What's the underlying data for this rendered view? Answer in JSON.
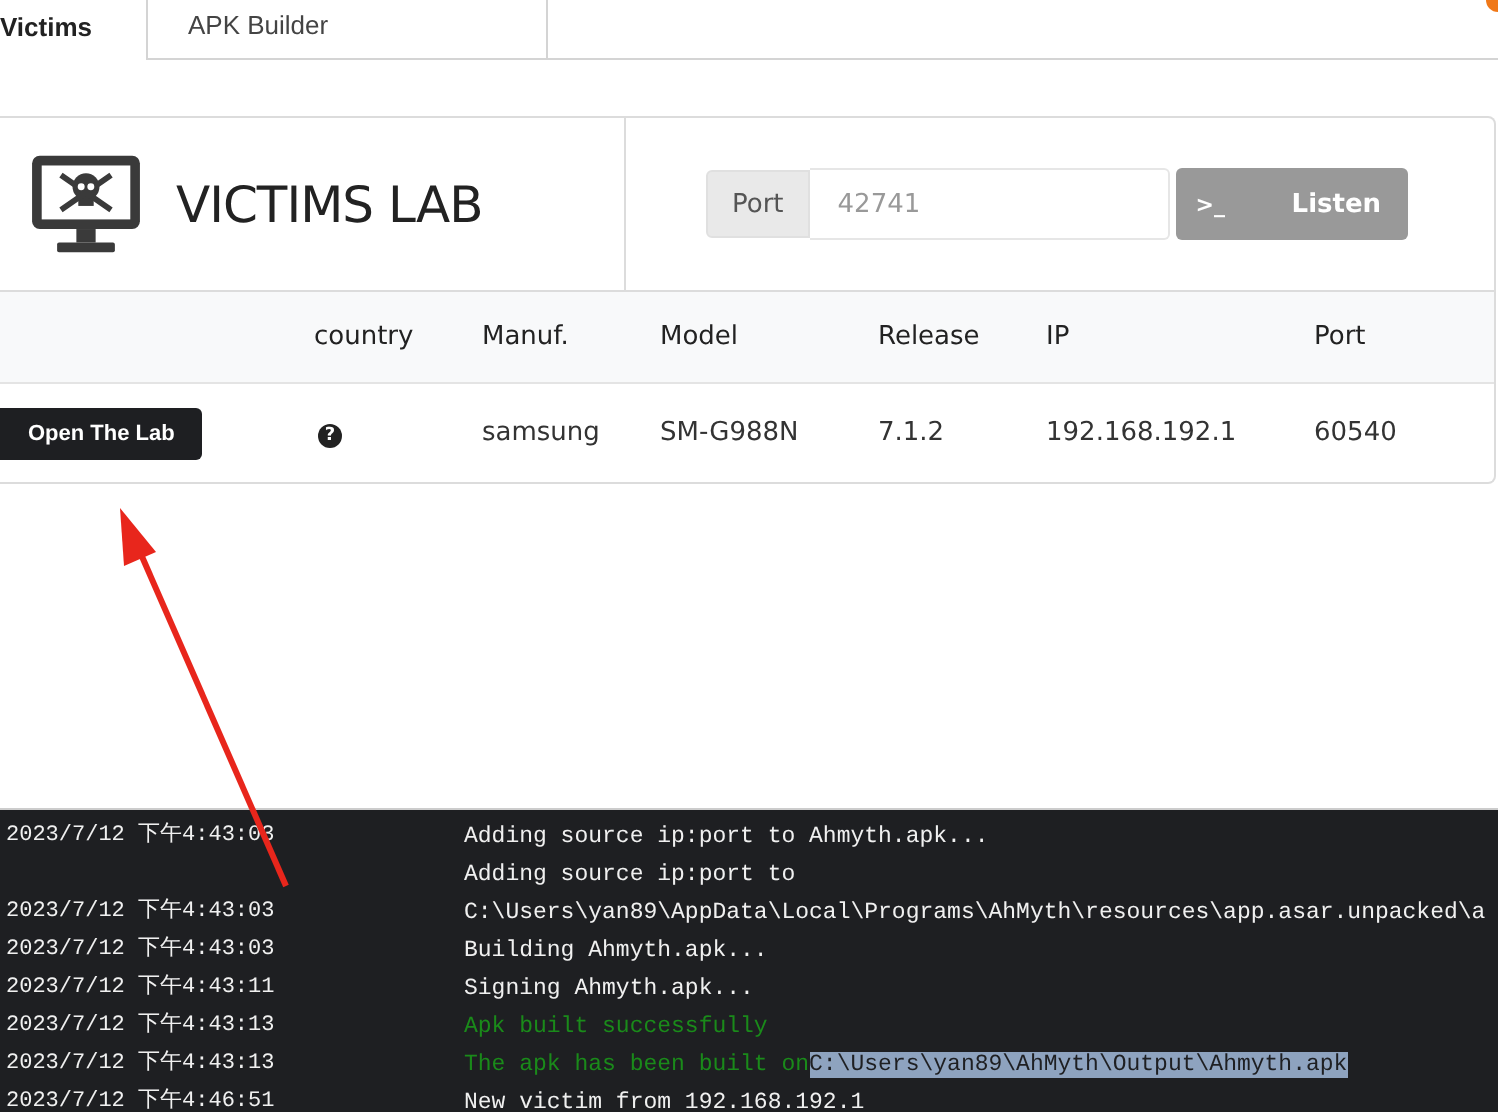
{
  "tabs": [
    {
      "label": "Victims",
      "selected": true
    },
    {
      "label": "APK Builder",
      "selected": false
    }
  ],
  "notification_dot": {
    "color": "#f07818"
  },
  "lab": {
    "title": "VICTIMS LAB",
    "port_label": "Port",
    "port_placeholder": "42741",
    "listen_button": {
      "icon": ">_",
      "label": "Listen",
      "disabled": true
    }
  },
  "table": {
    "columns": [
      "",
      "country",
      "Manuf.",
      "Model",
      "Release",
      "IP",
      "Port"
    ],
    "rows": [
      {
        "action": "Open The Lab",
        "country_icon": "?",
        "manufacturer": "samsung",
        "model": "SM-G988N",
        "release": "7.1.2",
        "ip": "192.168.192.1",
        "port": "60540"
      }
    ]
  },
  "log": [
    {
      "time": "2023/7/12 下午4:43:03",
      "message": "Adding source ip:port to Ahmyth.apk...",
      "kind": "info"
    },
    {
      "time": "2023/7/12 下午4:43:03",
      "message": "Adding source ip:port to C:\\Users\\yan89\\AppData\\Local\\Programs\\AhMyth\\resources\\app.asar.unpacked\\a",
      "kind": "info"
    },
    {
      "time": "2023/7/12 下午4:43:03",
      "message": "Building Ahmyth.apk...",
      "kind": "info"
    },
    {
      "time": "2023/7/12 下午4:43:11",
      "message": "Signing Ahmyth.apk...",
      "kind": "info"
    },
    {
      "time": "2023/7/12 下午4:43:13",
      "message": "Apk built successfully",
      "kind": "success"
    },
    {
      "time": "2023/7/12 下午4:43:13",
      "message": "The apk has been built on",
      "highlight": "C:\\Users\\yan89\\AhMyth\\Output\\Ahmyth.apk",
      "kind": "success"
    },
    {
      "time": "2023/7/12 下午4:46:51",
      "message": "New victim from 192.168.192.1",
      "kind": "info"
    }
  ]
}
